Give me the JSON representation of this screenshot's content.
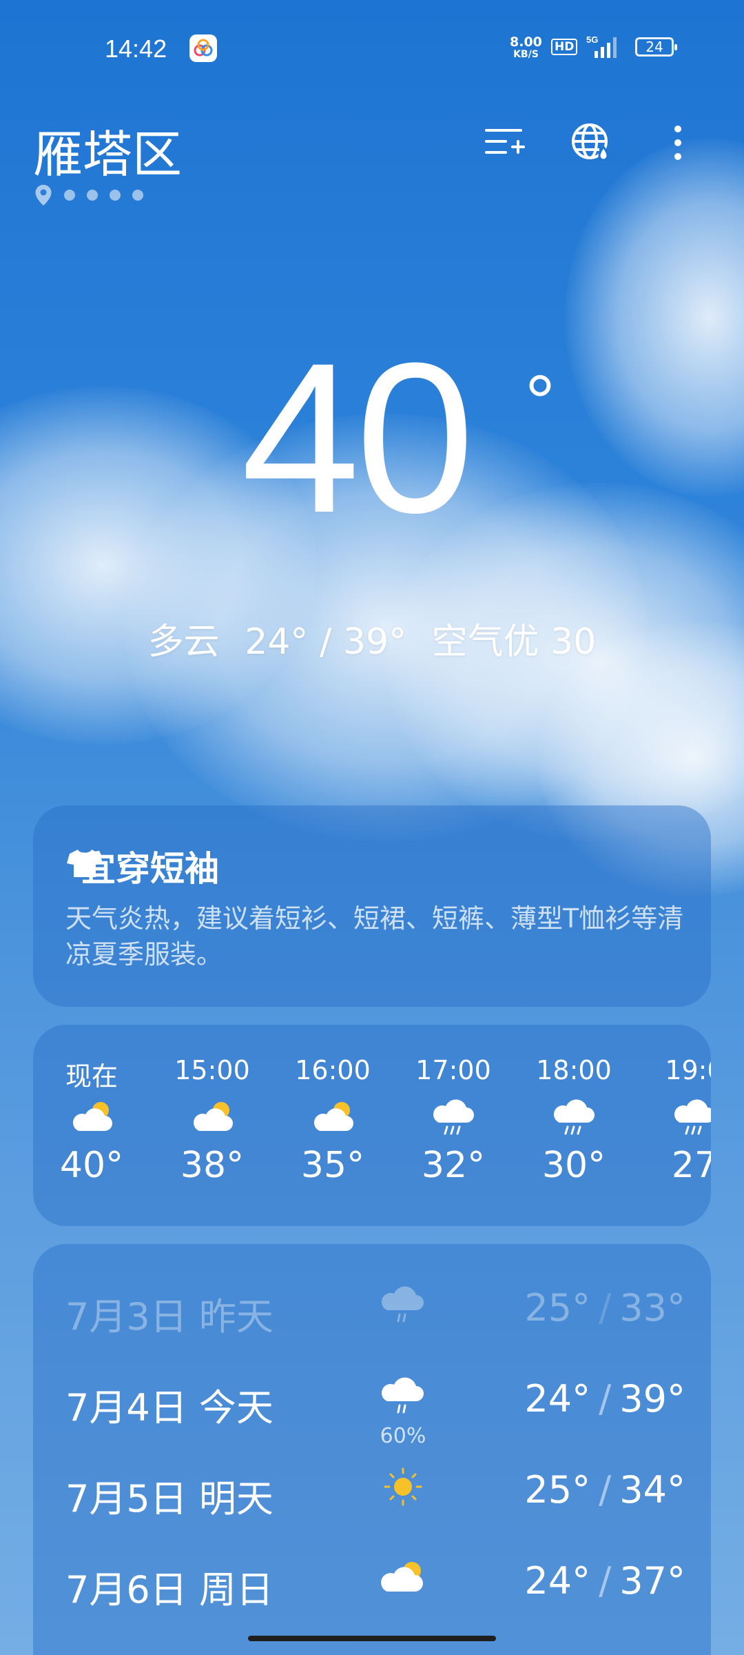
{
  "status_bar": {
    "time": "14:42",
    "net_speed": "8.00",
    "net_unit": "KB/S",
    "hd": "HD",
    "network": "5G",
    "battery": "24"
  },
  "location": {
    "city": "雁塔区"
  },
  "current": {
    "temperature": "40",
    "degree_symbol": "°",
    "condition": "多云",
    "range": "24° / 39°",
    "air": "空气优 30"
  },
  "dressing": {
    "title": "宜穿短袖",
    "text": "天气炎热，建议着短衫、短裙、短裤、薄型T恤衫等清凉夏季服装。"
  },
  "hourly": [
    {
      "time": "现在",
      "icon": "partly-cloudy-icon",
      "temp": "40°"
    },
    {
      "time": "15:00",
      "icon": "partly-cloudy-icon",
      "temp": "38°"
    },
    {
      "time": "16:00",
      "icon": "partly-cloudy-icon",
      "temp": "35°"
    },
    {
      "time": "17:00",
      "icon": "rain-icon",
      "temp": "32°"
    },
    {
      "time": "18:00",
      "icon": "rain-icon",
      "temp": "30°"
    },
    {
      "time": "19:0",
      "icon": "rain-icon",
      "temp": "27"
    }
  ],
  "daily": [
    {
      "date": "7月3日 昨天",
      "icon": "rain-icon",
      "low": "25°",
      "high": "33°",
      "slash": "/",
      "precip": ""
    },
    {
      "date": "7月4日 今天",
      "icon": "rain-icon",
      "low": "24°",
      "high": "39°",
      "slash": "/",
      "precip": "60%"
    },
    {
      "date": "7月5日 明天",
      "icon": "sun-icon",
      "low": "25°",
      "high": "34°",
      "slash": "/",
      "precip": ""
    },
    {
      "date": "7月6日 周日",
      "icon": "partly-cloudy-icon",
      "low": "24°",
      "high": "37°",
      "slash": "/",
      "precip": ""
    }
  ],
  "colors": {
    "sun": "#f7c12a",
    "cloud": "#ffffff",
    "card": "#2a6fc8"
  }
}
